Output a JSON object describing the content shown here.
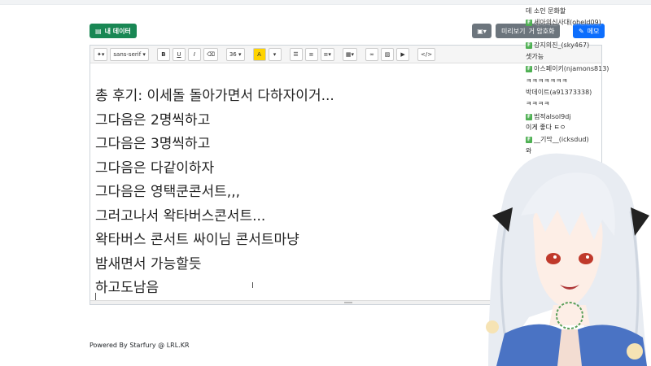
{
  "header": {
    "my_data_button": "내 데이터",
    "preview_button": "미리보기",
    "overlay_button": "거 암호화",
    "memo_button": "메모"
  },
  "toolbar": {
    "font_family": "sans-serif",
    "font_size": "36",
    "bold": "B",
    "underline": "U",
    "italic": "I",
    "code": "</>"
  },
  "editor": {
    "lines": [
      "총 후기: 이세돌 돌아가면서 다하자이거...",
      "그다음은 2명씩하고",
      "그다음은 3명씩하고",
      "그다음은 다같이하자",
      "그다음은 영택쿤콘서트,,,",
      "그러고나서 왁타버스콘서트...",
      "왁타버스 콘서트 싸이님 콘서트마냥",
      "밤새면서 가능할듯",
      "하고도남음"
    ]
  },
  "footer": {
    "text": "Powered By Starfury @ LRL.KR"
  },
  "chat": {
    "messages": [
      {
        "name": "",
        "text": "데 소인 문화할"
      },
      {
        "name": "세아의신사대(oheld09)",
        "text": ""
      },
      {
        "name": "강지의진_(sky467)",
        "text": ""
      },
      {
        "name": "",
        "text": "셋가능"
      },
      {
        "name": "아스페이키(njamons813)",
        "text": ""
      },
      {
        "name": "",
        "text": "ㅋㅋㅋㅋㅋㅋㅋ"
      },
      {
        "name": "박데이트(a91373338)",
        "text": ""
      },
      {
        "name": "",
        "text": "ㅋㅋㅋㅋ"
      },
      {
        "name": "범적alsol9dj",
        "text": ""
      },
      {
        "name": "",
        "text": "이게 좋다 ㅌㅇ"
      },
      {
        "name": "__기막__(icksdud)",
        "text": ""
      },
      {
        "name": "",
        "text": "와"
      }
    ]
  }
}
